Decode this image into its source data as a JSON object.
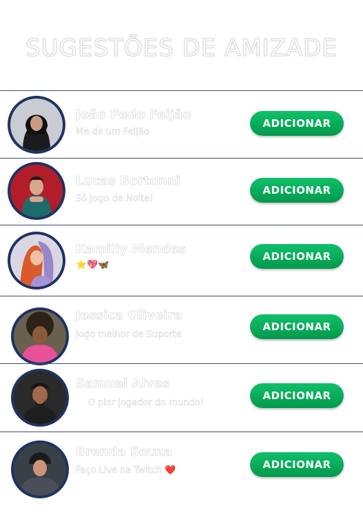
{
  "page": {
    "title": "SUGESTÕES DE AMIZADE"
  },
  "colors": {
    "button": "#03994c",
    "avatar_border": "#1f3363",
    "divider": "#3d4c70"
  },
  "suggestions": [
    {
      "name": "João Pedo Feijão",
      "status": " Me de um Feijão",
      "emoji": "",
      "button_label": "ADICIONAR"
    },
    {
      "name": "Lucas Bortonni",
      "status": " Só Jogo de Noite!",
      "emoji": "",
      "button_label": "ADICIONAR"
    },
    {
      "name": "Kamilly Mendes",
      "status": "",
      "emoji": "⭐💖🦋",
      "button_label": "ADICIONAR"
    },
    {
      "name": "Jessica Oliveira",
      "status": "Jogo melhor de Suporte",
      "emoji": "😍",
      "button_label": "ADICIONAR"
    },
    {
      "name": "Samuel Alves",
      "status": " O pior jogador do mundo!",
      "emoji": "😝",
      "button_label": "ADICIONAR"
    },
    {
      "name": "Brenda Souza",
      "status": "Faço Live na Twitch ",
      "emoji": "❤️",
      "button_label": "ADICIONAR"
    }
  ]
}
